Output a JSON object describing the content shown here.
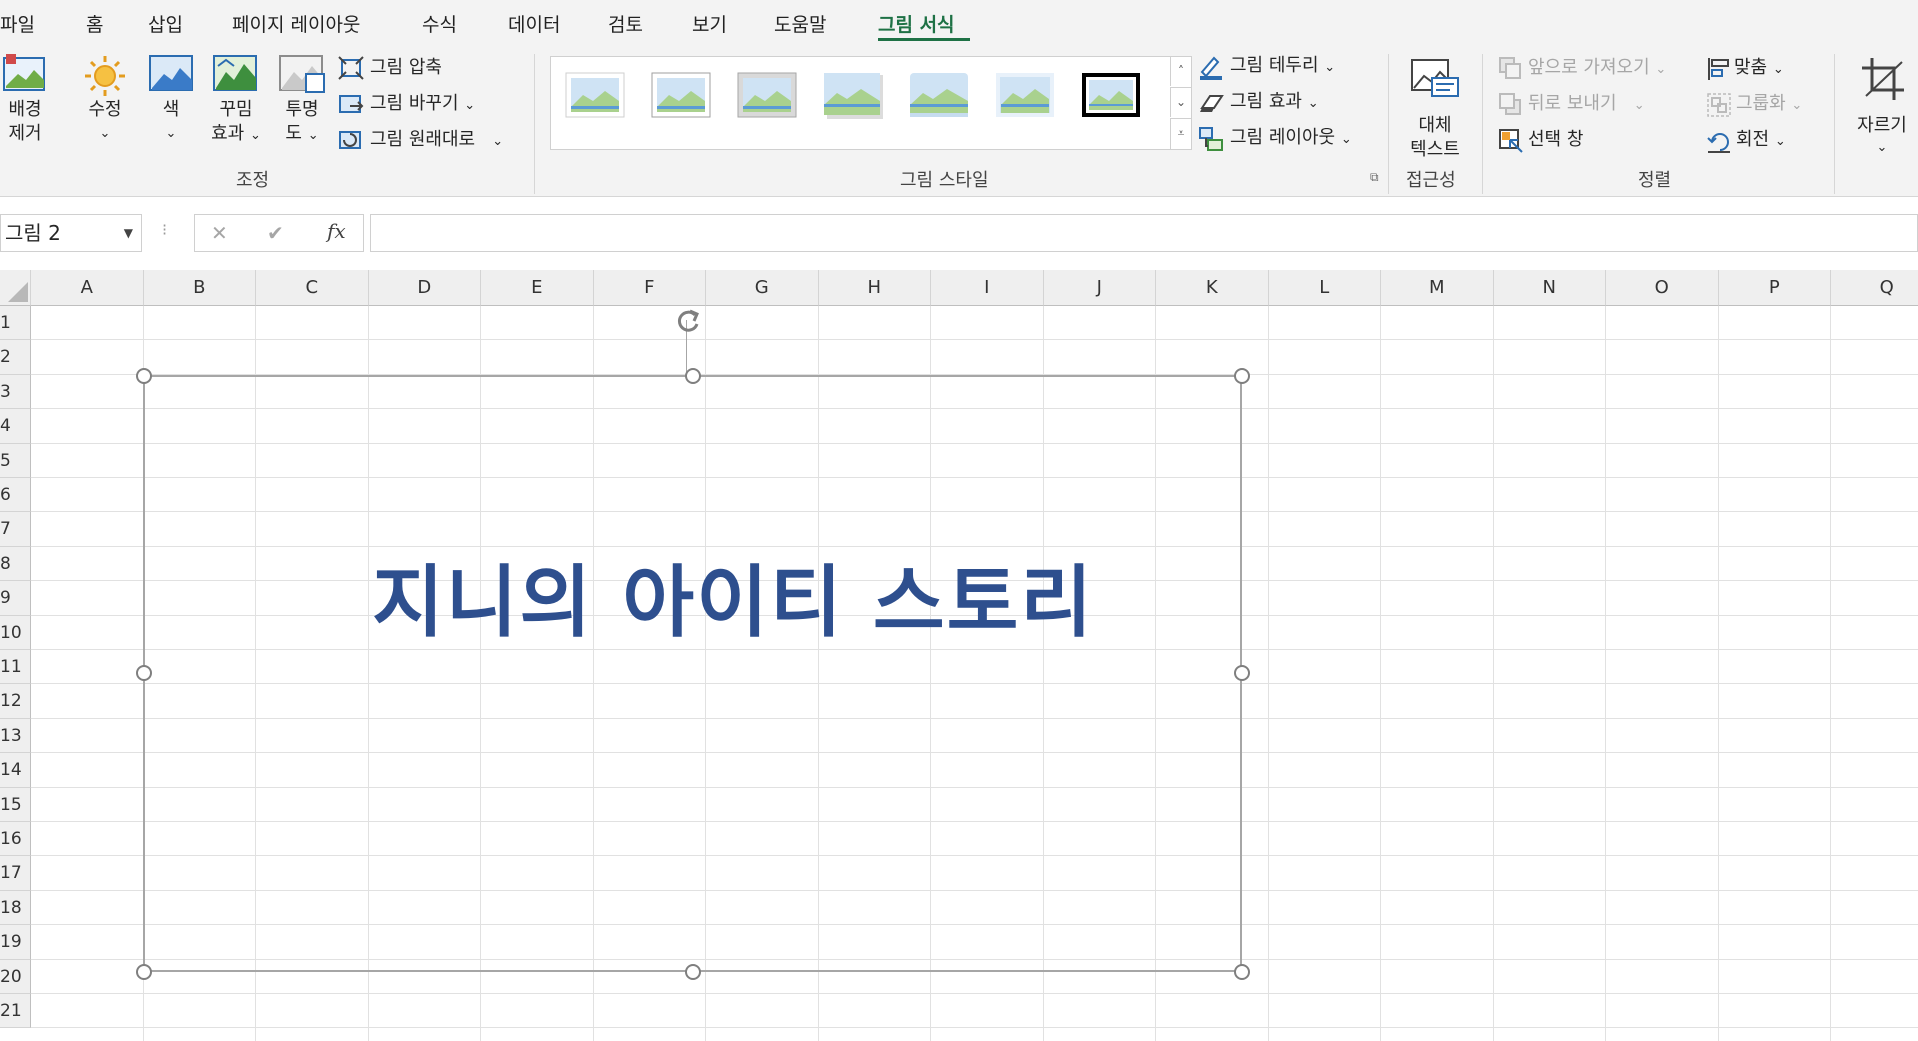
{
  "tabs": [
    "파일",
    "홈",
    "삽입",
    "페이지 레이아웃",
    "수식",
    "데이터",
    "검토",
    "보기",
    "도움말",
    "그림 서식"
  ],
  "ribbon": {
    "adjust": {
      "remove_bg": [
        "배경",
        "제거"
      ],
      "corrections": "수정",
      "color": "색",
      "artistic": [
        "꾸밈",
        "효과"
      ],
      "transparency": [
        "투명",
        "도"
      ],
      "compress": "그림 압축",
      "change": "그림 바꾸기",
      "reset": "그림 원래대로",
      "group_label": "조정"
    },
    "styles": {
      "border": "그림 테두리",
      "effects": "그림 효과",
      "layout": "그림 레이아웃",
      "group_label": "그림 스타일"
    },
    "accessibility": {
      "alt_text": [
        "대체",
        "텍스트"
      ],
      "group_label": "접근성"
    },
    "arrange": {
      "bring_forward": "앞으로 가져오기",
      "send_backward": "뒤로 보내기",
      "selection_pane": "선택 창",
      "align": "맞춤",
      "group": "그룹화",
      "rotate": "회전",
      "group_label": "정렬"
    },
    "size": {
      "crop": "자르기"
    }
  },
  "formula_bar": {
    "name_box": "그림 2",
    "cancel": "✕",
    "enter": "✔",
    "fx": "fx"
  },
  "columns": [
    "A",
    "B",
    "C",
    "D",
    "E",
    "F",
    "G",
    "H",
    "I",
    "J",
    "K",
    "L",
    "M",
    "N",
    "O",
    "P",
    "Q"
  ],
  "rows": [
    "1",
    "2",
    "3",
    "4",
    "5",
    "6",
    "7",
    "8",
    "9",
    "10",
    "11",
    "12",
    "13",
    "14",
    "15",
    "16",
    "17",
    "18",
    "19",
    "20",
    "21"
  ],
  "picture": {
    "text": "지니의 아이티 스토리"
  },
  "colors": {
    "accent": "#1e7145",
    "picture_text": "#2e4f8e"
  }
}
